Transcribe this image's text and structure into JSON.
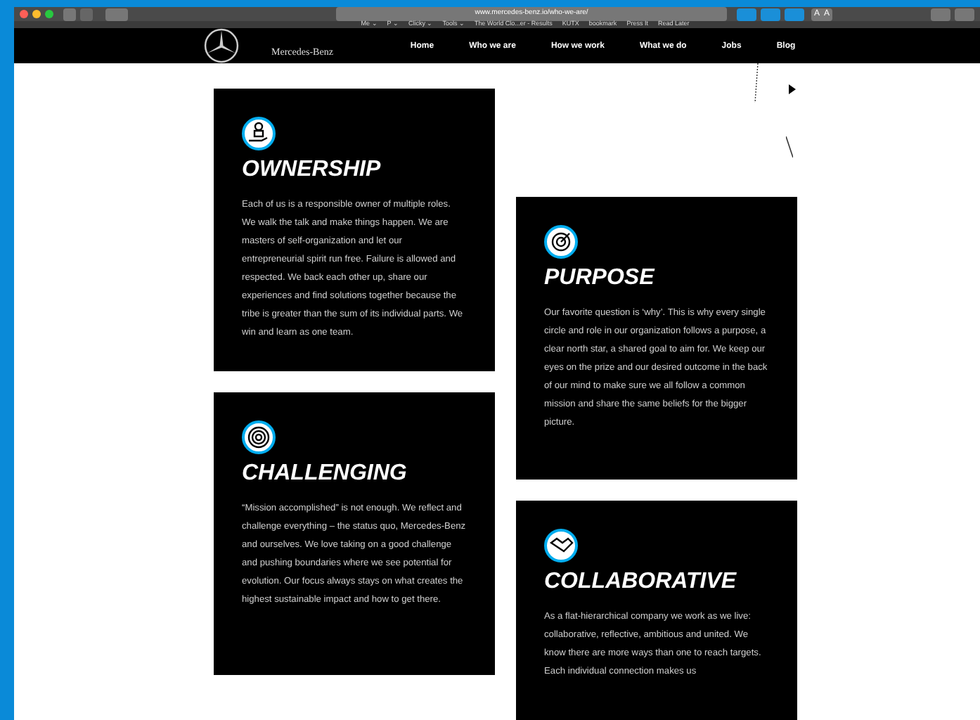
{
  "browser": {
    "url": "www.mercedes-benz.io/who-we-are/",
    "reader_buttons": [
      "A",
      "A"
    ],
    "bookmarks": [
      "Me ⌄",
      "P ⌄",
      "Clicky ⌄",
      "Tools ⌄",
      "The World Clo...er - Results",
      "KUTX",
      "bookmark",
      "Press It",
      "Read Later"
    ]
  },
  "site": {
    "brand": "Mercedes-Benz",
    "nav": [
      {
        "label": "Home"
      },
      {
        "label": "Who we are"
      },
      {
        "label": "How we work"
      },
      {
        "label": "What we do"
      },
      {
        "label": "Jobs"
      },
      {
        "label": "Blog"
      }
    ]
  },
  "columns": [
    [
      {
        "kind": "person",
        "title": "OWNERSHIP",
        "text": "Each of us is a responsible owner of multiple roles. We walk the talk and make things happen. We are masters of self-organization and let our entrepreneurial spirit run free. Failure is allowed and respected. We back each other up, share our experiences and find solutions together because the tribe is greater than the sum of its individual parts. We win and learn as one team."
      },
      {
        "kind": "maze",
        "title": "CHALLENGING",
        "text": "“Mission accomplished” is not enough. We reflect and challenge everything – the status quo, Mercedes-Benz and ourselves. We love taking on a good challenge and pushing boundaries where we see potential for evolution. Our focus always stays on what creates the highest sustainable impact and how to get there."
      }
    ],
    [
      {
        "kind": "target",
        "title": "PURPOSE",
        "text": "Our favorite question is ‘why’. This is why every single circle and role in our organization follows a purpose, a clear north star, a shared goal to aim for. We keep our eyes on the prize and our desired outcome in the back of our mind to make sure we all follow a common mission and share the same beliefs for the bigger picture."
      },
      {
        "kind": "handshake",
        "title": "COLLABORATIVE",
        "text": "As a flat-hierarchical company we work as we live: collaborative, reflective, ambitious and united. We know there are more ways than one to reach targets. Each individual connection makes us"
      }
    ]
  ]
}
